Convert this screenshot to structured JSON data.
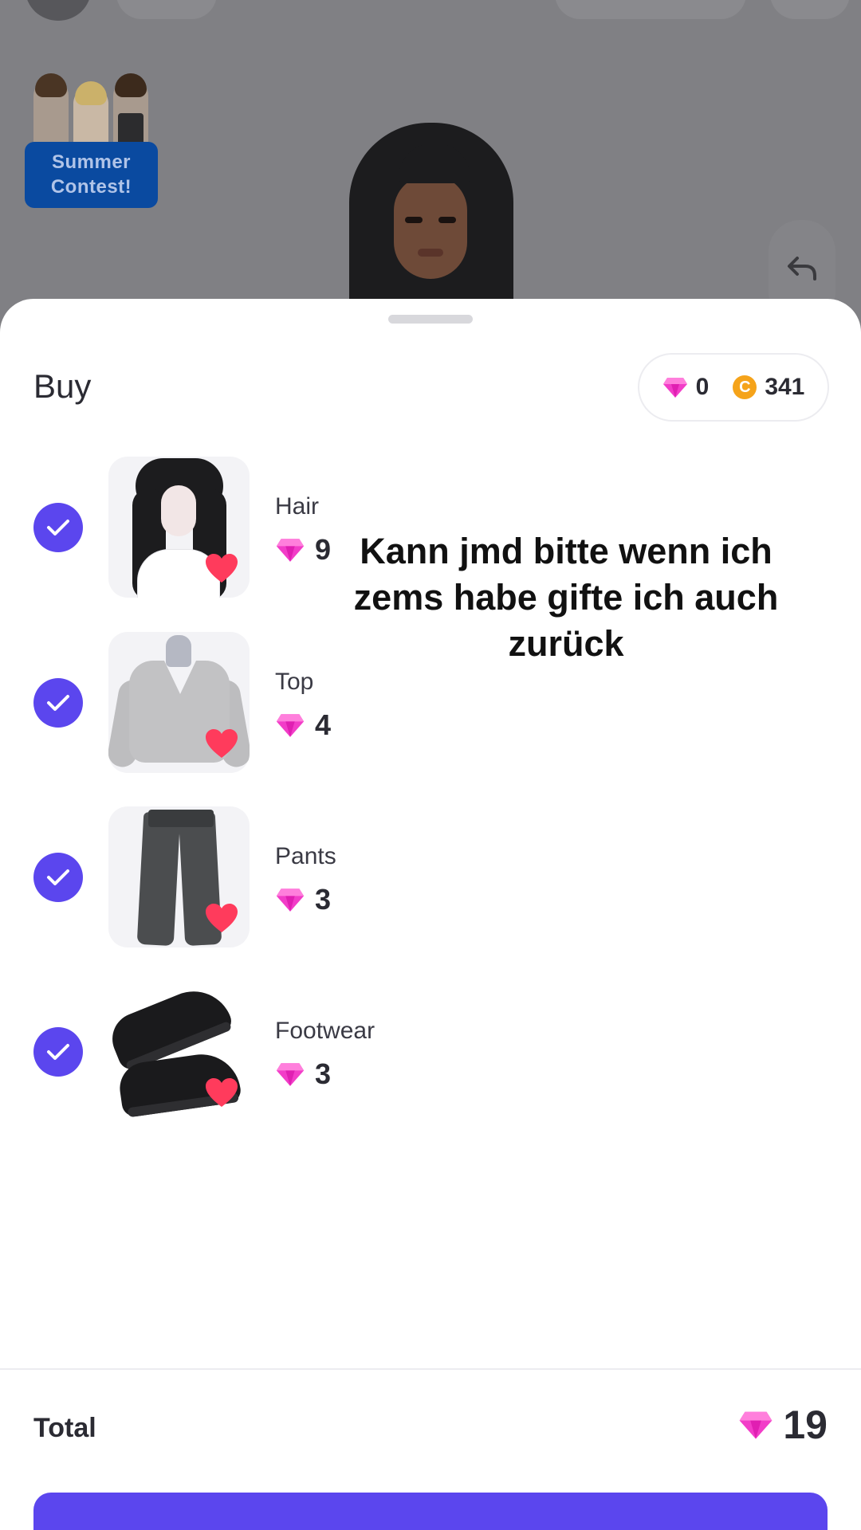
{
  "background": {
    "contest_badge": "Summer\nContest!"
  },
  "sheet": {
    "title": "Buy",
    "balance": {
      "gems": "0",
      "coins": "341",
      "coin_symbol": "C"
    },
    "items": [
      {
        "label": "Hair",
        "price": "9",
        "selected": true
      },
      {
        "label": "Top",
        "price": "4",
        "selected": true
      },
      {
        "label": "Pants",
        "price": "3",
        "selected": true
      },
      {
        "label": "Footwear",
        "price": "3",
        "selected": true
      }
    ],
    "overlay_caption": "Kann jmd bitte wenn ich zems habe gifte ich auch zurück",
    "total": {
      "label": "Total",
      "value": "19"
    }
  },
  "colors": {
    "accent": "#5b46ee",
    "gem": "#f23dc8",
    "coin": "#f5a31a",
    "heart": "#ff3b5c"
  },
  "icons": [
    "gem-icon",
    "coin-icon",
    "check-icon",
    "heart-icon",
    "undo-icon"
  ]
}
